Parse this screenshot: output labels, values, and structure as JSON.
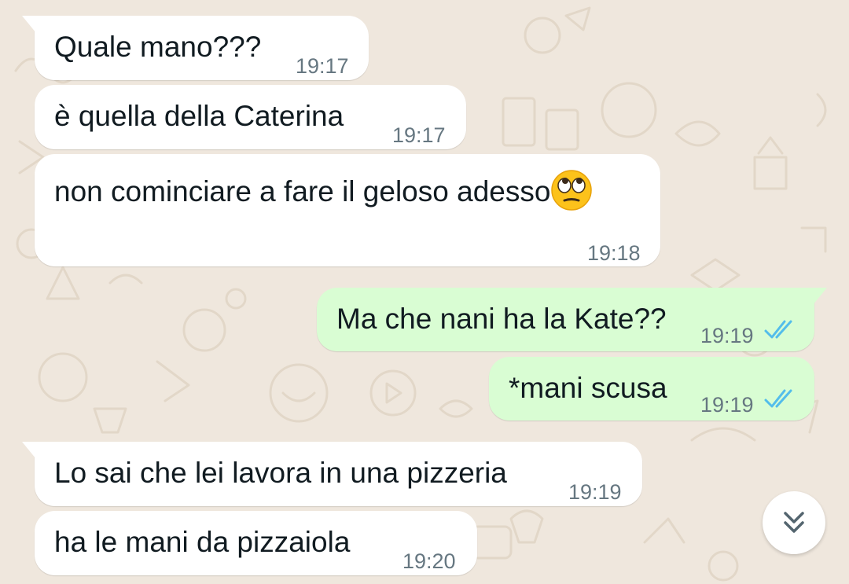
{
  "theme": {
    "wallpaper": "#efe7dd",
    "incoming_bubble": "#ffffff",
    "outgoing_bubble": "#d9fdd3",
    "read_ticks": "#53bdeb",
    "time_color": "#667781"
  },
  "messages": [
    {
      "direction": "incoming",
      "text": "Quale mano???",
      "time": "19:17"
    },
    {
      "direction": "incoming",
      "text": "è quella della Caterina",
      "time": "19:17"
    },
    {
      "direction": "incoming",
      "text": "non cominciare a fare il geloso adesso",
      "emoji": "face-with-rolling-eyes",
      "time": "19:18"
    },
    {
      "direction": "outgoing",
      "text": "Ma che nani ha la Kate??",
      "time": "19:19",
      "status": "read"
    },
    {
      "direction": "outgoing",
      "text": "*mani scusa",
      "time": "19:19",
      "status": "read"
    },
    {
      "direction": "incoming",
      "text": "Lo sai che lei lavora in una pizzeria",
      "time": "19:19"
    },
    {
      "direction": "incoming",
      "text": "ha le mani da pizzaiola",
      "time": "19:20"
    }
  ],
  "scroll_to_bottom": {
    "icon": "double-chevron-down-icon"
  }
}
